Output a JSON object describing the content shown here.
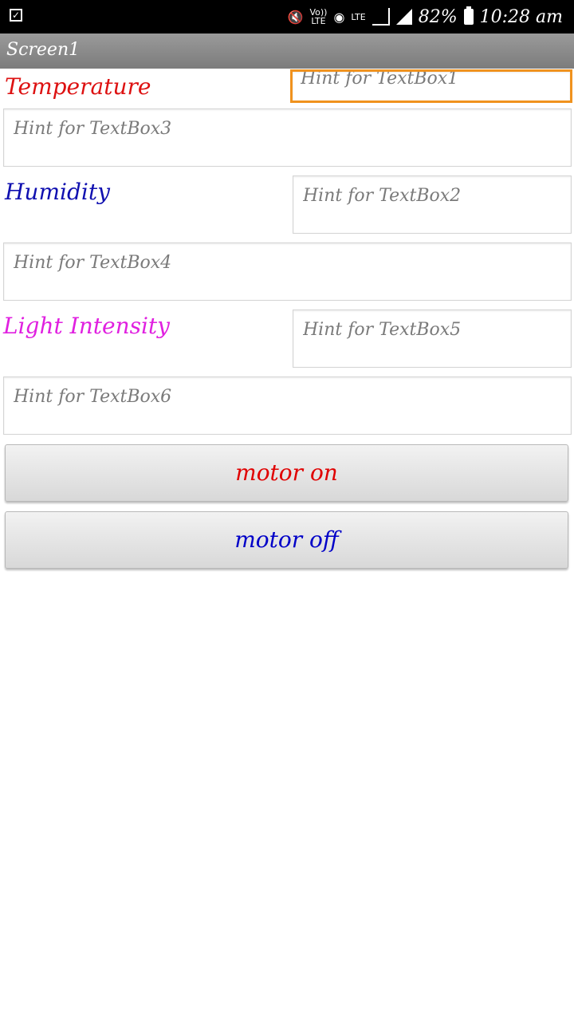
{
  "status_bar": {
    "volte": "Vo))\nLTE",
    "lte": "LTE",
    "battery_percent": "82%",
    "time": "10:28 am"
  },
  "title_bar": {
    "title": "Screen1"
  },
  "labels": {
    "temperature": "Temperature",
    "humidity": "Humidity",
    "light_intensity": "Light Intensity"
  },
  "textboxes": {
    "textbox1": {
      "placeholder": "Hint for TextBox1",
      "value": ""
    },
    "textbox2": {
      "placeholder": "Hint for TextBox2",
      "value": ""
    },
    "textbox3": {
      "placeholder": "Hint for TextBox3",
      "value": ""
    },
    "textbox4": {
      "placeholder": "Hint for TextBox4",
      "value": ""
    },
    "textbox5": {
      "placeholder": "Hint for TextBox5",
      "value": ""
    },
    "textbox6": {
      "placeholder": "Hint for TextBox6",
      "value": ""
    }
  },
  "buttons": {
    "motor_on": "motor on",
    "motor_off": "motor off"
  },
  "colors": {
    "temperature_label": "#dd1111",
    "humidity_label": "#1010b0",
    "light_label": "#e020e0",
    "motor_on_text": "#e00000",
    "motor_off_text": "#0000c8",
    "focus_border": "#f0921e"
  },
  "icons": {
    "notification": "checkbox-icon",
    "mute": "mute-vibrate-icon",
    "data": "globe-data-icon",
    "signal": "signal-icon",
    "battery": "battery-icon"
  }
}
